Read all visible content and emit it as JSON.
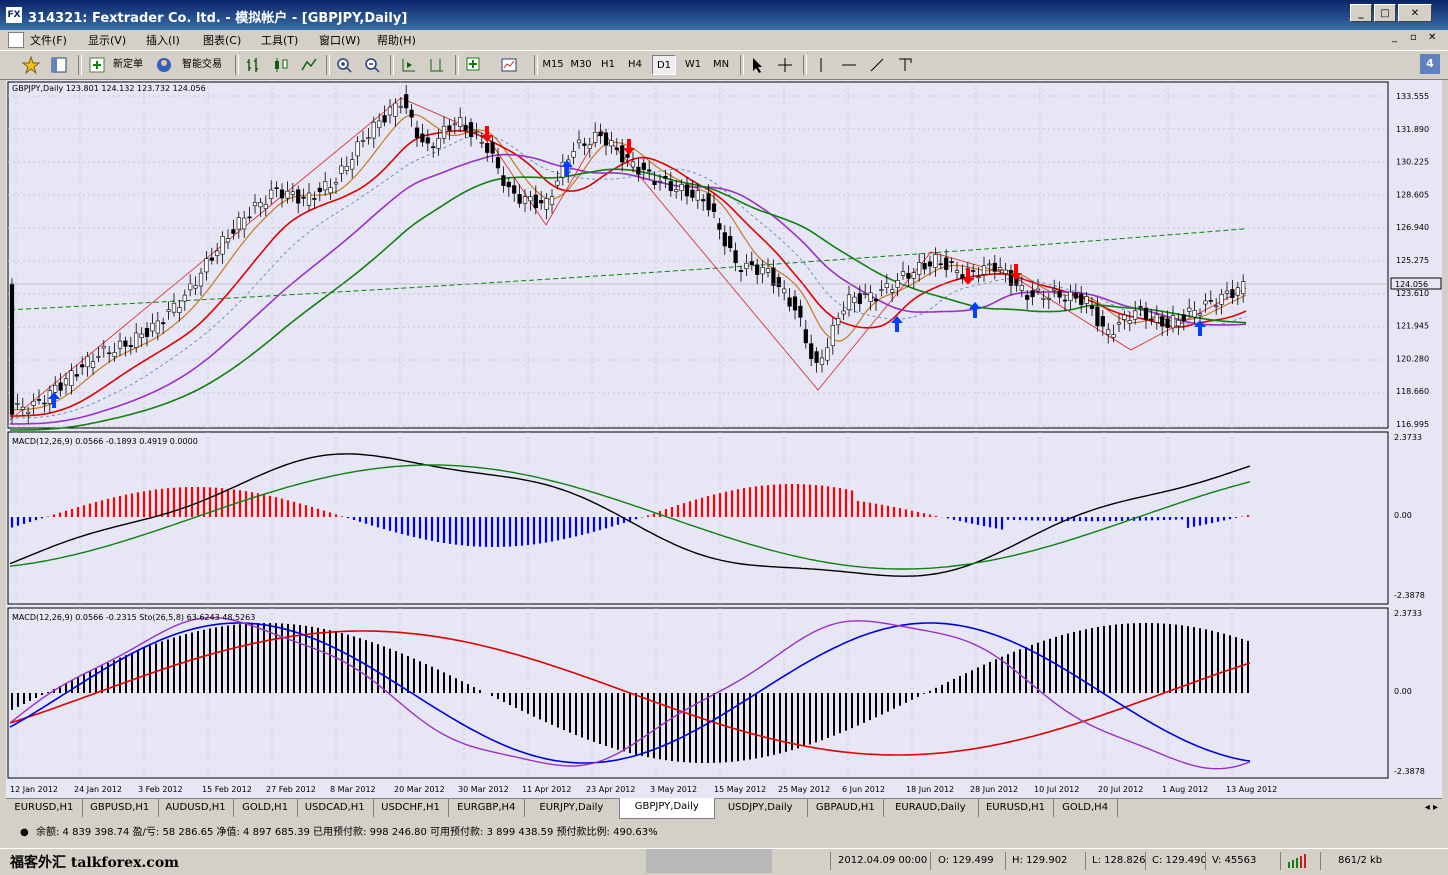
{
  "window": {
    "title": "314321: Fextrader Co. ltd. - 模拟帐户 - [GBPJPY,Daily]",
    "app_icon": "FX"
  },
  "menu": [
    "文件(F)",
    "显示(V)",
    "插入(I)",
    "图表(C)",
    "工具(T)",
    "窗口(W)",
    "帮助(H)"
  ],
  "toolbar": {
    "new_order": "新定单",
    "expert_trading": "智能交易",
    "timeframes": [
      "M15",
      "M30",
      "H1",
      "H4",
      "D1",
      "W1",
      "MN"
    ],
    "active_timeframe": "D1",
    "right_badge": "4"
  },
  "chart": {
    "header": "GBPJPY,Daily  123.801 124.132 123.732 124.056",
    "current_price": "124.056",
    "price_labels": [
      "133.555",
      "131.890",
      "130.225",
      "128.605",
      "126.940",
      "125.275",
      "123.610",
      "121.945",
      "120.280",
      "118.660",
      "116.995"
    ],
    "macd1": {
      "header": "MACD(12,26,9) 0.0566 -0.1893 0.4919 0.0000",
      "labels": [
        "2.3733",
        "0.00",
        "-2.3878"
      ]
    },
    "macd2": {
      "header": "MACD(12,26,9) 0.0566 -0.2315  Sto(26,5,8) 63.6243 48.5263",
      "labels": [
        "2.3733",
        "0.00",
        "-2.3878"
      ]
    },
    "dates": [
      "12 Jan 2012",
      "24 Jan 2012",
      "3 Feb 2012",
      "15 Feb 2012",
      "27 Feb 2012",
      "8 Mar 2012",
      "20 Mar 2012",
      "30 Mar 2012",
      "11 Apr 2012",
      "23 Apr 2012",
      "3 May 2012",
      "15 May 2012",
      "25 May 2012",
      "6 Jun 2012",
      "18 Jun 2012",
      "28 Jun 2012",
      "10 Jul 2012",
      "20 Jul 2012",
      "1 Aug 2012",
      "13 Aug 2012"
    ]
  },
  "tabs": [
    "EURUSD,H1",
    "GBPUSD,H1",
    "AUDUSD,H1",
    "GOLD,H1",
    "USDCAD,H1",
    "USDCHF,H1",
    "EURGBP,H4",
    "EURJPY,Daily",
    "GBPJPY,Daily",
    "USDJPY,Daily",
    "GBPAUD,H1",
    "EURAUD,Daily",
    "EURUSD,H1",
    "GOLD,H4"
  ],
  "active_tab": "GBPJPY,Daily",
  "account": "余额: 4 839 398.74  盈/亏: 58 286.65  净值: 4 897 685.39  已用预付款: 998 246.80  可用预付款: 3 899 438.59  预付款比例: 490.63%",
  "status": {
    "watermark": "福客外汇 talkforex.com",
    "datetime": "2012.04.09 00:00",
    "open": "O: 129.499",
    "high": "H: 129.902",
    "low": "L: 128.826",
    "close": "C: 129.490",
    "volume": "V: 45563",
    "traffic": "861/2 kb"
  },
  "colors": {
    "chart_bg": "#e6e6f5",
    "ma_red": "#e00000",
    "ma_orange": "#c87820",
    "ma_purple": "#9a30c8",
    "ma_green": "#108010",
    "macd_up": "#ff0000",
    "macd_down": "#0000ff",
    "signal_up": "#0040ff",
    "signal_down": "#ff0000"
  }
}
